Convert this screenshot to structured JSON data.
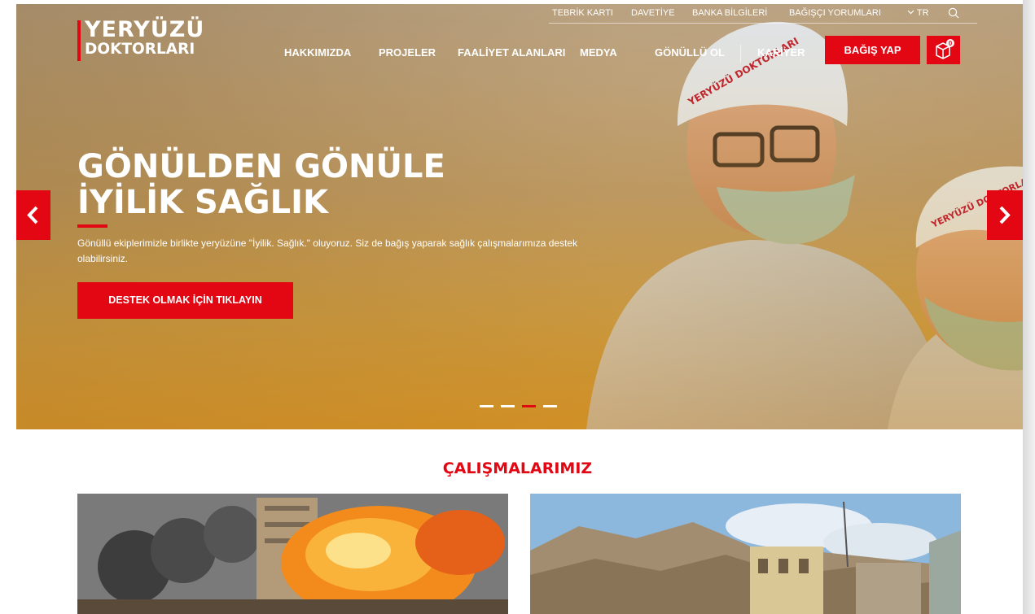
{
  "brand": {
    "logo_line1": "YERYÜZÜ",
    "logo_line2": "DOKTORLARI",
    "accent_color": "#e30613"
  },
  "utility_nav": [
    "TEBRİK KARTI",
    "DAVETİYE",
    "BANKA BİLGİLERİ",
    "BAĞIŞÇI YORUMLARI"
  ],
  "language": "TR",
  "icons": {
    "language_chevron": "chevron-down-icon",
    "search": "search-icon",
    "cart": "gift-box-icon",
    "cart_badge": "0",
    "prev": "chevron-left-icon",
    "next": "chevron-right-icon"
  },
  "main_nav": [
    "HAKKIMIZDA",
    "PROJELER",
    "FAALİYET ALANLARI",
    "MEDYA",
    "GÖNÜLLÜ OL",
    "KARİYER"
  ],
  "donate_button": "BAĞIŞ YAP",
  "hero": {
    "title_line1": "GÖNÜLDEN GÖNÜLE",
    "title_line2": "İYİLİK SAĞLIK",
    "description": "Gönüllü ekiplerimizle birlikte yeryüzüne \"İyilik. Sağlık.\" oluyoruz. Siz de bağış yaparak sağlık çalışmalarımıza destek olabilirsiniz.",
    "cta": "DESTEK OLMAK İÇİN TIKLAYIN",
    "cap_text_1": "YERYÜZÜ DOKTORLARI",
    "cap_text_2": "YERYÜZÜ DOKTORLARI",
    "slides_total": 4,
    "slide_active": 3
  },
  "section": {
    "title": "ÇALIŞMALARIMIZ",
    "cards": [
      {
        "image": "explosion-building-photo"
      },
      {
        "image": "earthquake-ruins-photo"
      }
    ]
  }
}
